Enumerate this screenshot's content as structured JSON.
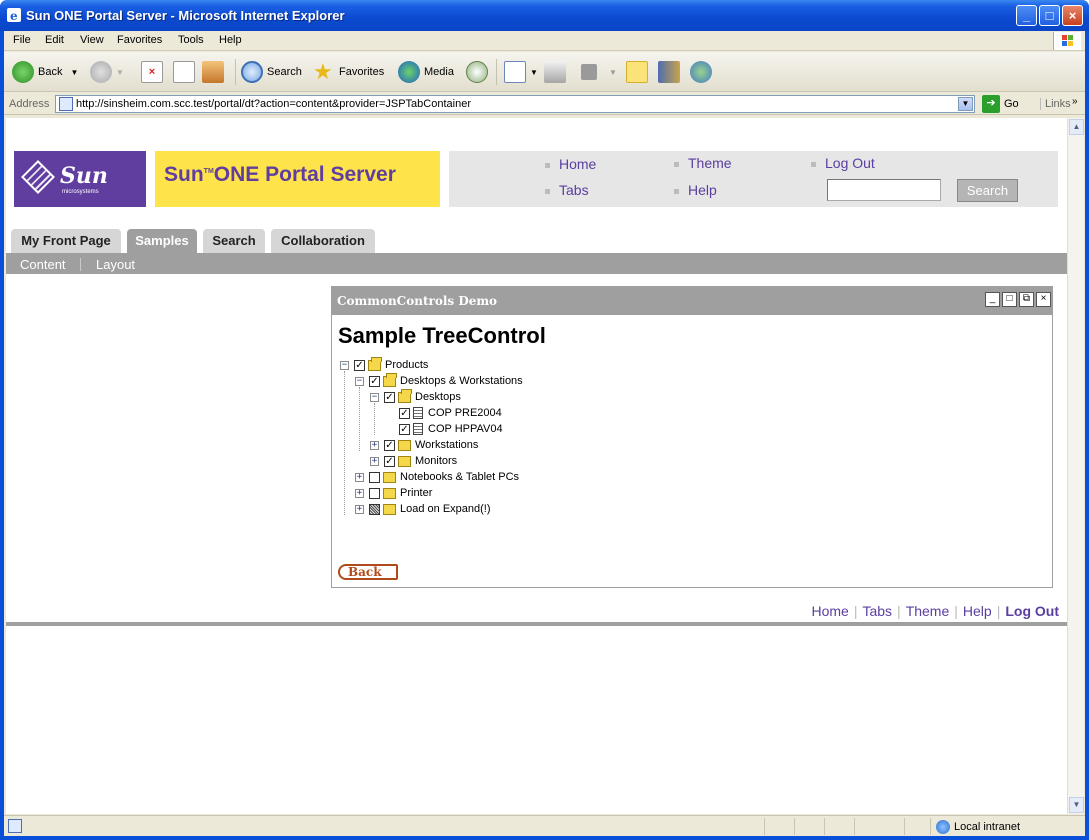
{
  "window": {
    "title": "Sun ONE Portal Server - Microsoft Internet Explorer"
  },
  "menu": {
    "items": [
      "File",
      "Edit",
      "View",
      "Favorites",
      "Tools",
      "Help"
    ]
  },
  "toolbar": {
    "back": "Back",
    "search": "Search",
    "favorites": "Favorites",
    "media": "Media"
  },
  "address": {
    "label": "Address",
    "url": "http://sinsheim.com.scc.test/portal/dt?action=content&provider=JSPTabContainer",
    "go": "Go",
    "links": "Links"
  },
  "status": {
    "zone": "Local intranet"
  },
  "header": {
    "logo_text": "Sun",
    "logo_sub": "microsystems",
    "banner_pre": "Sun",
    "banner_tm": "TM",
    "banner_post": "ONE Portal Server",
    "nav": {
      "home": "Home",
      "theme": "Theme",
      "logout": "Log Out",
      "tabs": "Tabs",
      "help": "Help"
    },
    "search_button": "Search",
    "search_value": ""
  },
  "tabs": [
    {
      "label": "My Front Page",
      "active": false
    },
    {
      "label": "Samples",
      "active": true
    },
    {
      "label": "Search",
      "active": false
    },
    {
      "label": "Collaboration",
      "active": false
    }
  ],
  "subtabs": [
    "Content",
    "Layout"
  ],
  "channel": {
    "title": "CommonControls Demo",
    "heading": "Sample TreeControl",
    "back": "Back",
    "tree": [
      {
        "label": "Products",
        "level": 0,
        "expander": "minus",
        "check": "checked",
        "icon": "folder-open"
      },
      {
        "label": "Desktops & Workstations",
        "level": 1,
        "expander": "minus",
        "check": "checked",
        "icon": "folder-open"
      },
      {
        "label": "Desktops",
        "level": 2,
        "expander": "minus",
        "check": "checked",
        "icon": "folder-open"
      },
      {
        "label": "COP PRE2004",
        "level": 3,
        "expander": "none",
        "check": "checked",
        "icon": "document"
      },
      {
        "label": "COP HPPAV04",
        "level": 3,
        "expander": "none",
        "check": "checked",
        "icon": "document"
      },
      {
        "label": "Workstations",
        "level": 2,
        "expander": "plus",
        "check": "checked",
        "icon": "folder"
      },
      {
        "label": "Monitors",
        "level": 2,
        "expander": "plus",
        "check": "checked",
        "icon": "folder"
      },
      {
        "label": "Notebooks & Tablet PCs",
        "level": 1,
        "expander": "plus",
        "check": "unchecked",
        "icon": "folder"
      },
      {
        "label": "Printer",
        "level": 1,
        "expander": "plus",
        "check": "unchecked",
        "icon": "folder"
      },
      {
        "label": "Load on Expand(!)",
        "level": 1,
        "expander": "plus",
        "check": "partial",
        "icon": "folder"
      }
    ]
  },
  "footer": {
    "home": "Home",
    "tabs": "Tabs",
    "theme": "Theme",
    "help": "Help",
    "logout": "Log Out"
  }
}
